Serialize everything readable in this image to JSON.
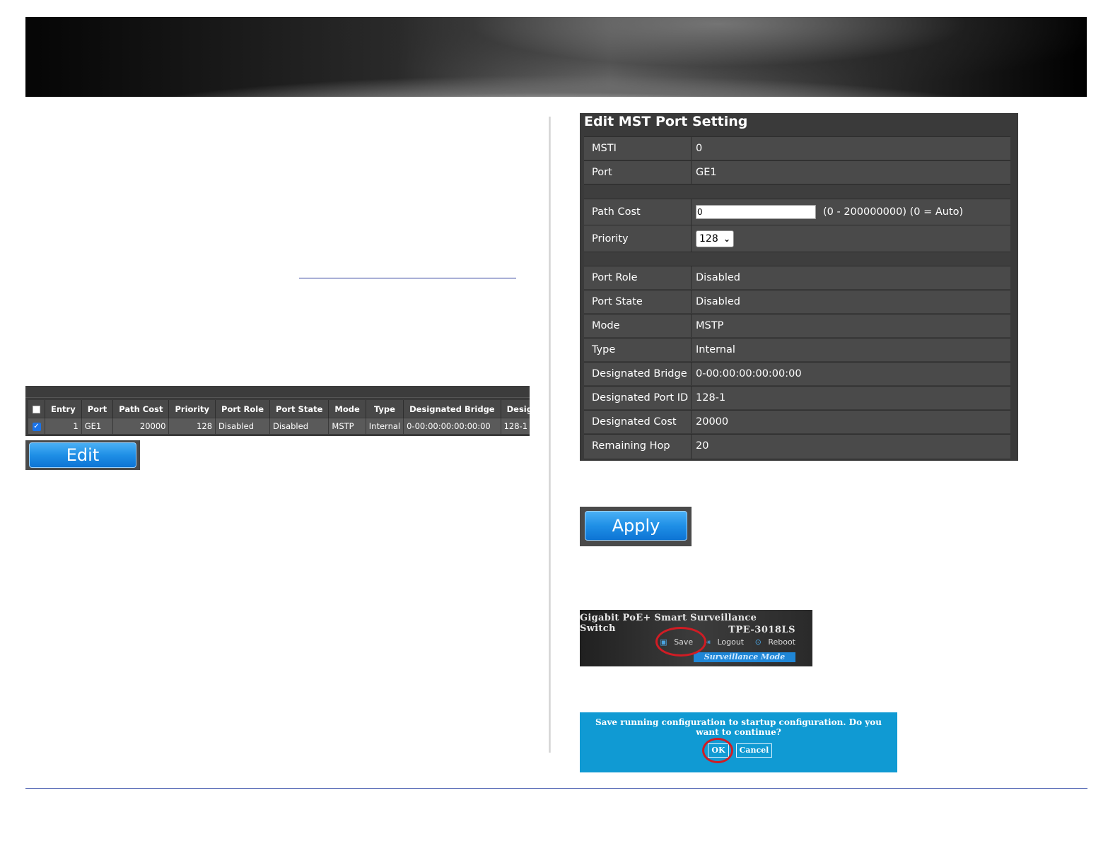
{
  "port_table": {
    "headers": [
      "Entry",
      "Port",
      "Path Cost",
      "Priority",
      "Port Role",
      "Port State",
      "Mode",
      "Type",
      "Designated Bridge",
      "Design"
    ],
    "row": [
      "1",
      "GE1",
      "20000",
      "128",
      "Disabled",
      "Disabled",
      "MSTP",
      "Internal",
      "0-00:00:00:00:00:00",
      "128-1"
    ],
    "edit_label": "Edit"
  },
  "mst_panel": {
    "title": "Edit MST Port Setting",
    "msti_label": "MSTI",
    "msti_value": "0",
    "port_label": "Port",
    "port_value": "GE1",
    "path_cost_label": "Path Cost",
    "path_cost_value": "0",
    "path_cost_hint": "(0 - 200000000) (0 = Auto)",
    "priority_label": "Priority",
    "priority_value": "128",
    "port_role_label": "Port Role",
    "port_role_value": "Disabled",
    "port_state_label": "Port State",
    "port_state_value": "Disabled",
    "mode_label": "Mode",
    "mode_value": "MSTP",
    "type_label": "Type",
    "type_value": "Internal",
    "designated_bridge_label": "Designated Bridge",
    "designated_bridge_value": "0-00:00:00:00:00:00",
    "designated_port_id_label": "Designated Port ID",
    "designated_port_id_value": "128-1",
    "designated_cost_label": "Designated Cost",
    "designated_cost_value": "20000",
    "remaining_hop_label": "Remaining Hop",
    "remaining_hop_value": "20"
  },
  "apply_label": "Apply",
  "header": {
    "product": "Gigabit PoE+ Smart Surveillance Switch",
    "model": "TPE-3018LS",
    "save": "Save",
    "logout": "Logout",
    "reboot": "Reboot",
    "mode": "Surveillance Mode"
  },
  "dialog": {
    "message": "Save running configuration to startup configuration. Do you want to continue?",
    "ok": "OK",
    "cancel": "Cancel"
  }
}
